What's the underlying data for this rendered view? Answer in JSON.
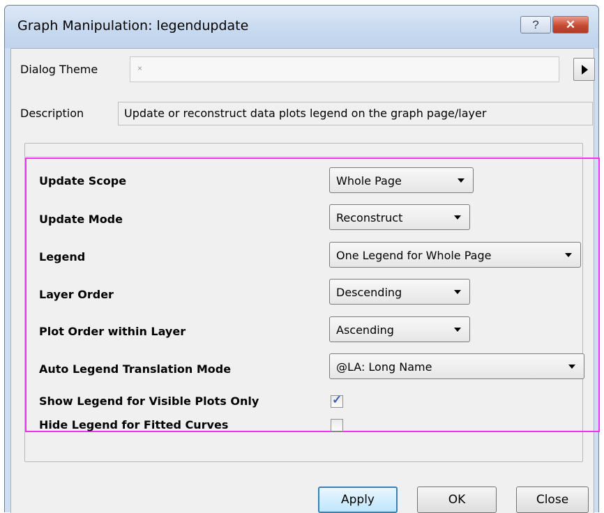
{
  "window": {
    "title": "Graph Manipulation: legendupdate",
    "help_label": "?",
    "close_label": "✕"
  },
  "theme": {
    "label": "Dialog Theme",
    "value": "×"
  },
  "description": {
    "label": "Description",
    "text": "Update or reconstruct data plots legend on the graph page/layer"
  },
  "rows": [
    {
      "label": "Update Scope",
      "value": "Whole Page"
    },
    {
      "label": "Update Mode",
      "value": "Reconstruct"
    },
    {
      "label": "Legend",
      "value": "One Legend for Whole Page"
    },
    {
      "label": "Layer Order",
      "value": "Descending"
    },
    {
      "label": "Plot Order within Layer",
      "value": "Ascending"
    },
    {
      "label": "Auto Legend Translation Mode",
      "value": "@LA: Long Name"
    }
  ],
  "checks": [
    {
      "label": "Show Legend for Visible Plots Only",
      "checked": true
    },
    {
      "label": "Hide Legend for Fitted Curves",
      "checked": false
    }
  ],
  "buttons": {
    "apply": "Apply",
    "ok": "OK",
    "close": "Close"
  },
  "colors": {
    "highlight": "#ee33ee",
    "check_mark": "#3a5fb5"
  }
}
